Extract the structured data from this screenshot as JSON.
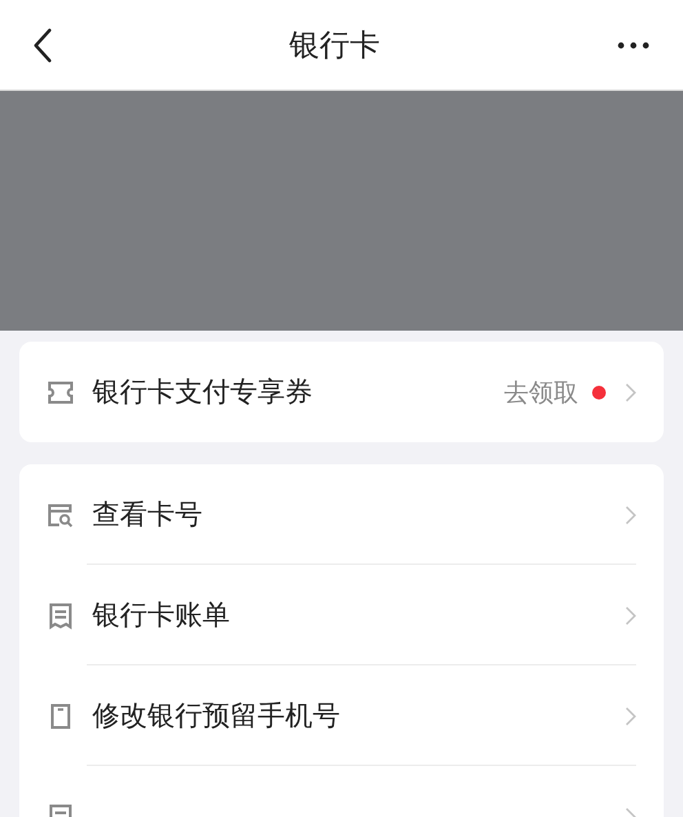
{
  "header": {
    "title": "银行卡"
  },
  "promo": {
    "label": "银行卡支付专享券",
    "action": "去领取",
    "dot": true,
    "kind": "ticket"
  },
  "menu": [
    {
      "label": "查看卡号",
      "kind": "card-search"
    },
    {
      "label": "银行卡账单",
      "kind": "receipt"
    },
    {
      "label": "修改银行预留手机号",
      "kind": "phone"
    },
    {
      "kind": "receipt"
    }
  ]
}
